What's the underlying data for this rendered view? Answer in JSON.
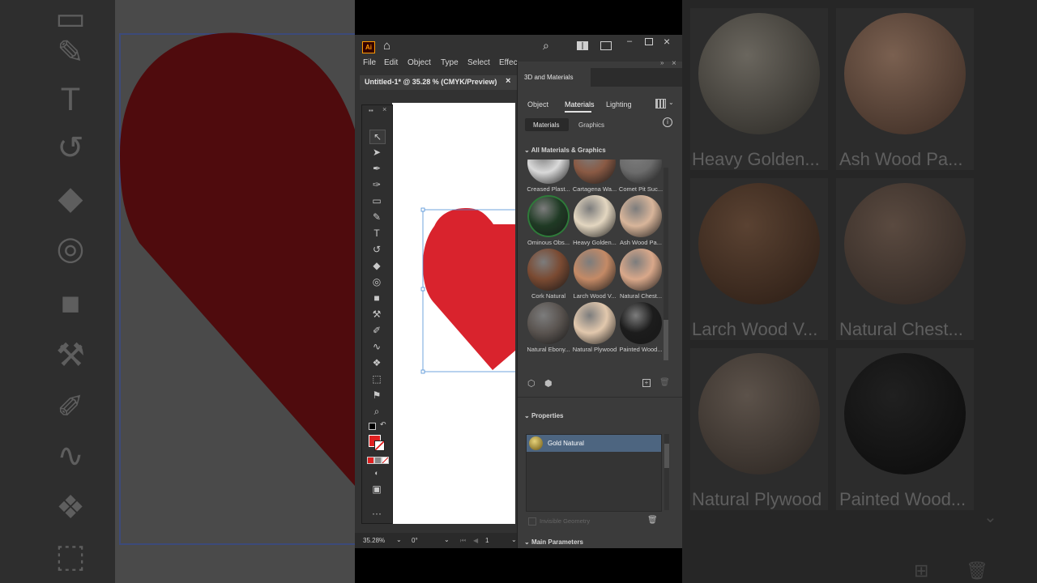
{
  "app": {
    "logo": "Ai",
    "menu": [
      "File",
      "Edit",
      "Object",
      "Type",
      "Select",
      "Effec"
    ],
    "document_tab": "Untitled-1* @ 35.28 % (CMYK/Preview)",
    "close_glyph": "×"
  },
  "status": {
    "zoom": "35.28%",
    "rotation": "0°",
    "page": "1"
  },
  "panel": {
    "title": "3D and Materials",
    "tabs": [
      "Object",
      "Materials",
      "Lighting"
    ],
    "active_tab": "Materials",
    "subtabs": [
      "Materials",
      "Graphics"
    ],
    "section_all": "All Materials & Graphics",
    "materials": [
      {
        "label": "Creased Plast...",
        "color": "#d9d9d9"
      },
      {
        "label": "Cartagena Wa...",
        "color": "#8a5a44"
      },
      {
        "label": "Comet Pit Suc...",
        "color": "#6c6c6c"
      },
      {
        "label": "Ominous Obs...",
        "color": "#1f3a24"
      },
      {
        "label": "Heavy Golden...",
        "color": "#e3d6c0"
      },
      {
        "label": "Ash Wood Pa...",
        "color": "#d8b59a"
      },
      {
        "label": "Cork Natural",
        "color": "#7a4a32"
      },
      {
        "label": "Larch Wood V...",
        "color": "#c48a66"
      },
      {
        "label": "Natural Chest...",
        "color": "#d9a88a"
      },
      {
        "label": "Natural Ebony...",
        "color": "#5a5450"
      },
      {
        "label": "Natural Plywood",
        "color": "#e2c8ad"
      },
      {
        "label": "Painted Wood...",
        "color": "#1c1c1c"
      }
    ],
    "section_properties": "Properties",
    "selected_material": "Gold Natural",
    "invisible_geometry": "Invisible Geometry",
    "section_main": "Main Parameters"
  },
  "background": {
    "labels": [
      "Heavy Golden...",
      "Ash Wood Pa...",
      "Larch Wood V...",
      "Natural Chest...",
      "Natural Plywood",
      "Painted Wood..."
    ]
  },
  "colors": {
    "heart": "#d9232d",
    "selection": "#4e8fd6",
    "fill": "#e02020"
  }
}
